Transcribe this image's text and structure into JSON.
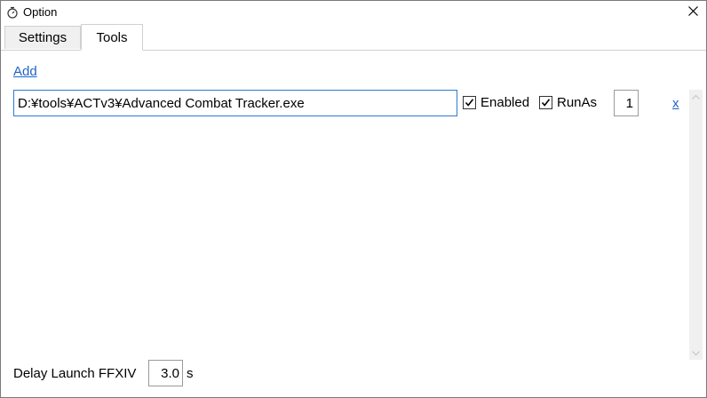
{
  "window": {
    "title": "Option",
    "close_glyph": "✕"
  },
  "tabs": [
    {
      "label": "Settings",
      "selected": false
    },
    {
      "label": "Tools",
      "selected": true
    }
  ],
  "tools": {
    "add_label": "Add",
    "entries": [
      {
        "path": "D:¥tools¥ACTv3¥Advanced Combat Tracker.exe",
        "enabled_label": "Enabled",
        "enabled_checked": true,
        "runas_label": "RunAs",
        "runas_checked": true,
        "order": "1",
        "remove_label": "x"
      }
    ]
  },
  "delay": {
    "label": "Delay Launch FFXIV",
    "value": "3.0",
    "unit": "s"
  },
  "colors": {
    "link": "#1e64c8",
    "focus_border": "#2f7ad6"
  },
  "icons": {
    "app": "timer-icon",
    "close": "close-icon",
    "check": "checkmark-icon"
  }
}
